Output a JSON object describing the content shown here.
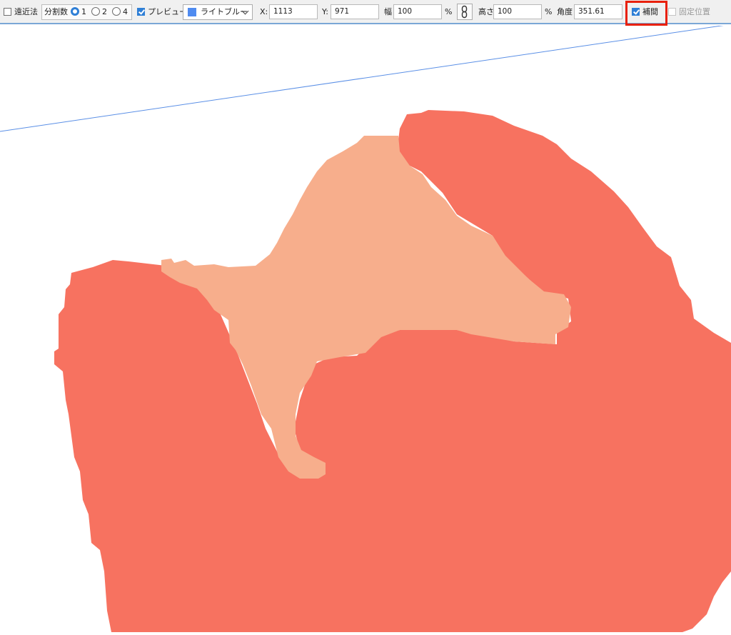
{
  "toolbar": {
    "perspective_label": "遠近法",
    "perspective_checked": false,
    "divisions_label": "分割数",
    "divisions_options": [
      "1",
      "2",
      "4"
    ],
    "divisions_selected": "1",
    "preview_label": "プレビュー",
    "preview_checked": true,
    "color_select_value": "ライトブルー",
    "color_swatch": "#4f8bf0",
    "x_label": "X:",
    "x_value": "1113",
    "y_label": "Y:",
    "y_value": "971",
    "width_label": "幅",
    "width_value": "100",
    "width_unit": "%",
    "height_label": "高さ",
    "height_value": "100",
    "height_unit": "%",
    "angle_label": "角度",
    "angle_value": "351.61",
    "interpolation_label": "補間",
    "interpolation_checked": true,
    "fixed_position_label": "固定位置",
    "fixed_position_checked": false
  },
  "canvas": {
    "colors": {
      "background": "#ffffff",
      "dark_shape": "#f77260",
      "light_shape": "#f7ae8c",
      "guide_line": "#5a8fe6",
      "highlight": "#e8200a"
    }
  }
}
